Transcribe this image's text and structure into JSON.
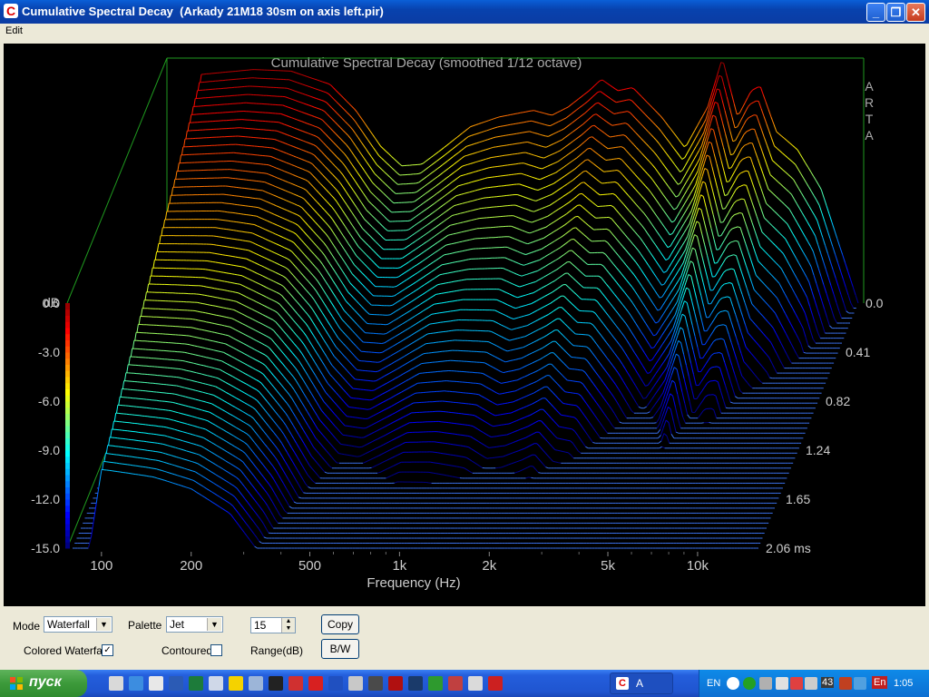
{
  "window": {
    "title": "Cumulative Spectral Decay  (Arkady 21M18 30sm on axis left.pir)",
    "minimize": "_",
    "maximize": "❐",
    "close": "✕"
  },
  "menu": {
    "edit": "Edit"
  },
  "chart_data": {
    "type": "waterfall",
    "title": "Cumulative Spectral Decay (smoothed 1/12 octave)",
    "watermark": [
      "A",
      "R",
      "T",
      "A"
    ],
    "xlabel": "Frequency (Hz)",
    "x_ticks": [
      "100",
      "200",
      "500",
      "1k",
      "2k",
      "5k",
      "10k"
    ],
    "x_scale": "log",
    "z_label": "dB",
    "z_ticks": [
      "0.0",
      "-3.0",
      "-6.0",
      "-9.0",
      "-12.0",
      "-15.0"
    ],
    "z_range": [
      -15,
      0
    ],
    "time_ticks": [
      "0.0",
      "0.41",
      "0.82",
      "1.24",
      "1.65",
      "2.06 ms"
    ],
    "time_range_ms": [
      0,
      2.06
    ],
    "palette": "Jet",
    "range_db": 15,
    "slice_count": 50,
    "initial_response": [
      {
        "f": 80,
        "db": -13
      },
      {
        "f": 100,
        "db": -1
      },
      {
        "f": 150,
        "db": -0.7
      },
      {
        "f": 200,
        "db": -0.8
      },
      {
        "f": 270,
        "db": -1.6
      },
      {
        "f": 330,
        "db": -3.2
      },
      {
        "f": 400,
        "db": -5.4
      },
      {
        "f": 470,
        "db": -6.6
      },
      {
        "f": 550,
        "db": -6.5
      },
      {
        "f": 650,
        "db": -5.5
      },
      {
        "f": 800,
        "db": -4.2
      },
      {
        "f": 1000,
        "db": -3.6
      },
      {
        "f": 1300,
        "db": -3.2
      },
      {
        "f": 1500,
        "db": -3.5
      },
      {
        "f": 1700,
        "db": -3.0
      },
      {
        "f": 2000,
        "db": -2.0
      },
      {
        "f": 2200,
        "db": -1.3
      },
      {
        "f": 2500,
        "db": -2.0
      },
      {
        "f": 2800,
        "db": -1.8
      },
      {
        "f": 3500,
        "db": -3.6
      },
      {
        "f": 4200,
        "db": -5.5
      },
      {
        "f": 5000,
        "db": -3.0
      },
      {
        "f": 5600,
        "db": 0.0
      },
      {
        "f": 6300,
        "db": -3.6
      },
      {
        "f": 7000,
        "db": -2.0
      },
      {
        "f": 7500,
        "db": -1.7
      },
      {
        "f": 8500,
        "db": -4.5
      },
      {
        "f": 10000,
        "db": -5.6
      },
      {
        "f": 12000,
        "db": -8.0
      },
      {
        "f": 16000,
        "db": -15.0
      }
    ]
  },
  "controls": {
    "mode_label": "Mode",
    "mode_value": "Waterfall",
    "palette_label": "Palette",
    "palette_value": "Jet",
    "range_value": "15",
    "range_label": "Range(dB)",
    "copy_button": "Copy",
    "bw_button": "B/W",
    "colored_waterfall_label": "Colored Waterfall",
    "colored_waterfall_checked": "✓",
    "contoured_label": "Contoured"
  },
  "taskbar": {
    "start_label": "пуск",
    "task_label": "A",
    "tray_lang": "EN",
    "tray_number": "43",
    "tray_en": "En",
    "clock": "1:05"
  }
}
